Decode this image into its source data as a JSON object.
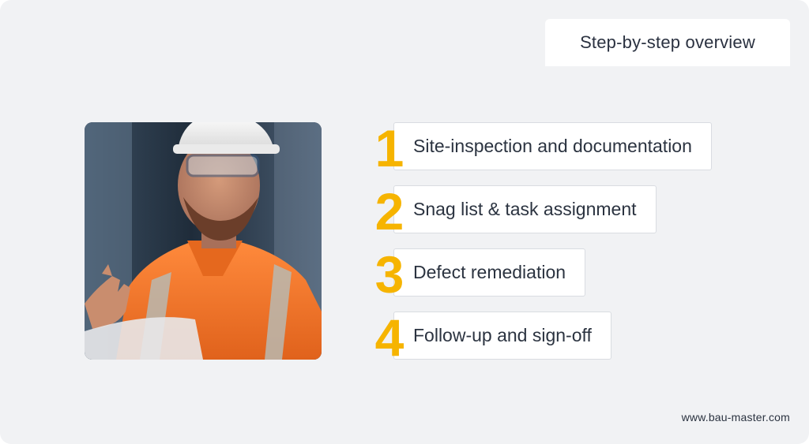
{
  "header": {
    "title": "Step-by-step overview"
  },
  "photo": {
    "icon": "construction-worker-photo"
  },
  "steps": [
    {
      "number": "1",
      "label": "Site-inspection and documentation"
    },
    {
      "number": "2",
      "label": "Snag list & task assignment"
    },
    {
      "number": "3",
      "label": "Defect remediation"
    },
    {
      "number": "4",
      "label": "Follow-up and sign-off"
    }
  ],
  "footer": {
    "website": "www.bau-master.com"
  },
  "colors": {
    "background": "#f1f2f4",
    "accent": "#f6b400",
    "text": "#2b3340",
    "card": "#ffffff"
  }
}
